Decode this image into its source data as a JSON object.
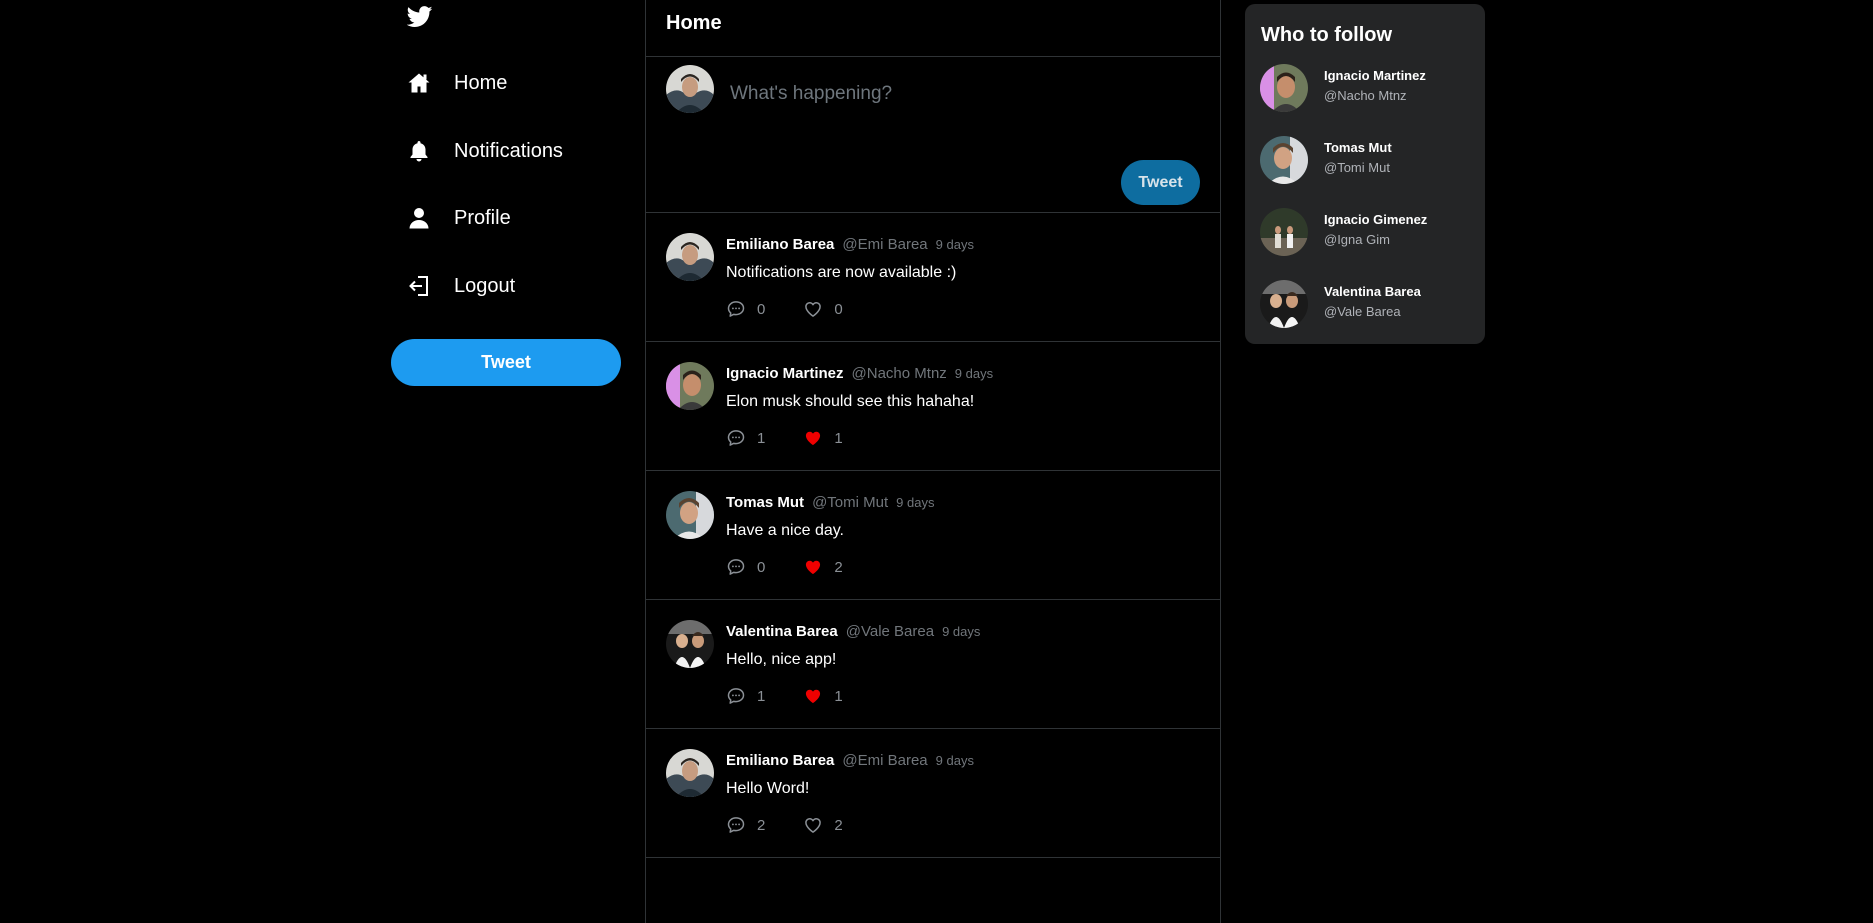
{
  "colors": {
    "background": "#000000",
    "accent": "#1d9bf0",
    "like_active": "#f00000",
    "panel": "#242526"
  },
  "sidebar": {
    "logo_icon": "twitter-bird-icon",
    "items": [
      {
        "label": "Home",
        "icon": "home-icon"
      },
      {
        "label": "Notifications",
        "icon": "bell-icon"
      },
      {
        "label": "Profile",
        "icon": "user-icon"
      },
      {
        "label": "Logout",
        "icon": "logout-icon"
      }
    ],
    "tweet_button": "Tweet"
  },
  "main": {
    "title": "Home",
    "composer": {
      "placeholder": "What's happening?",
      "button": "Tweet"
    },
    "tweets": [
      {
        "name": "Emiliano Barea",
        "handle": "@Emi Barea",
        "time": "9 days",
        "text": "Notifications are now available :)",
        "comments": "0",
        "likes": "0",
        "liked": false
      },
      {
        "name": "Ignacio Martinez",
        "handle": "@Nacho Mtnz",
        "time": "9 days",
        "text": "Elon musk should see this hahaha!",
        "comments": "1",
        "likes": "1",
        "liked": true
      },
      {
        "name": "Tomas Mut",
        "handle": "@Tomi Mut",
        "time": "9 days",
        "text": "Have a nice day.",
        "comments": "0",
        "likes": "2",
        "liked": true
      },
      {
        "name": "Valentina Barea",
        "handle": "@Vale Barea",
        "time": "9 days",
        "text": "Hello, nice app!",
        "comments": "1",
        "likes": "1",
        "liked": true
      },
      {
        "name": "Emiliano Barea",
        "handle": "@Emi Barea",
        "time": "9 days",
        "text": "Hello Word!",
        "comments": "2",
        "likes": "2",
        "liked": false
      }
    ]
  },
  "who_to_follow": {
    "title": "Who to follow",
    "users": [
      {
        "name": "Ignacio Martinez",
        "handle": "@Nacho Mtnz"
      },
      {
        "name": "Tomas Mut",
        "handle": "@Tomi Mut"
      },
      {
        "name": "Ignacio Gimenez",
        "handle": "@Igna Gim"
      },
      {
        "name": "Valentina Barea",
        "handle": "@Vale Barea"
      }
    ]
  }
}
